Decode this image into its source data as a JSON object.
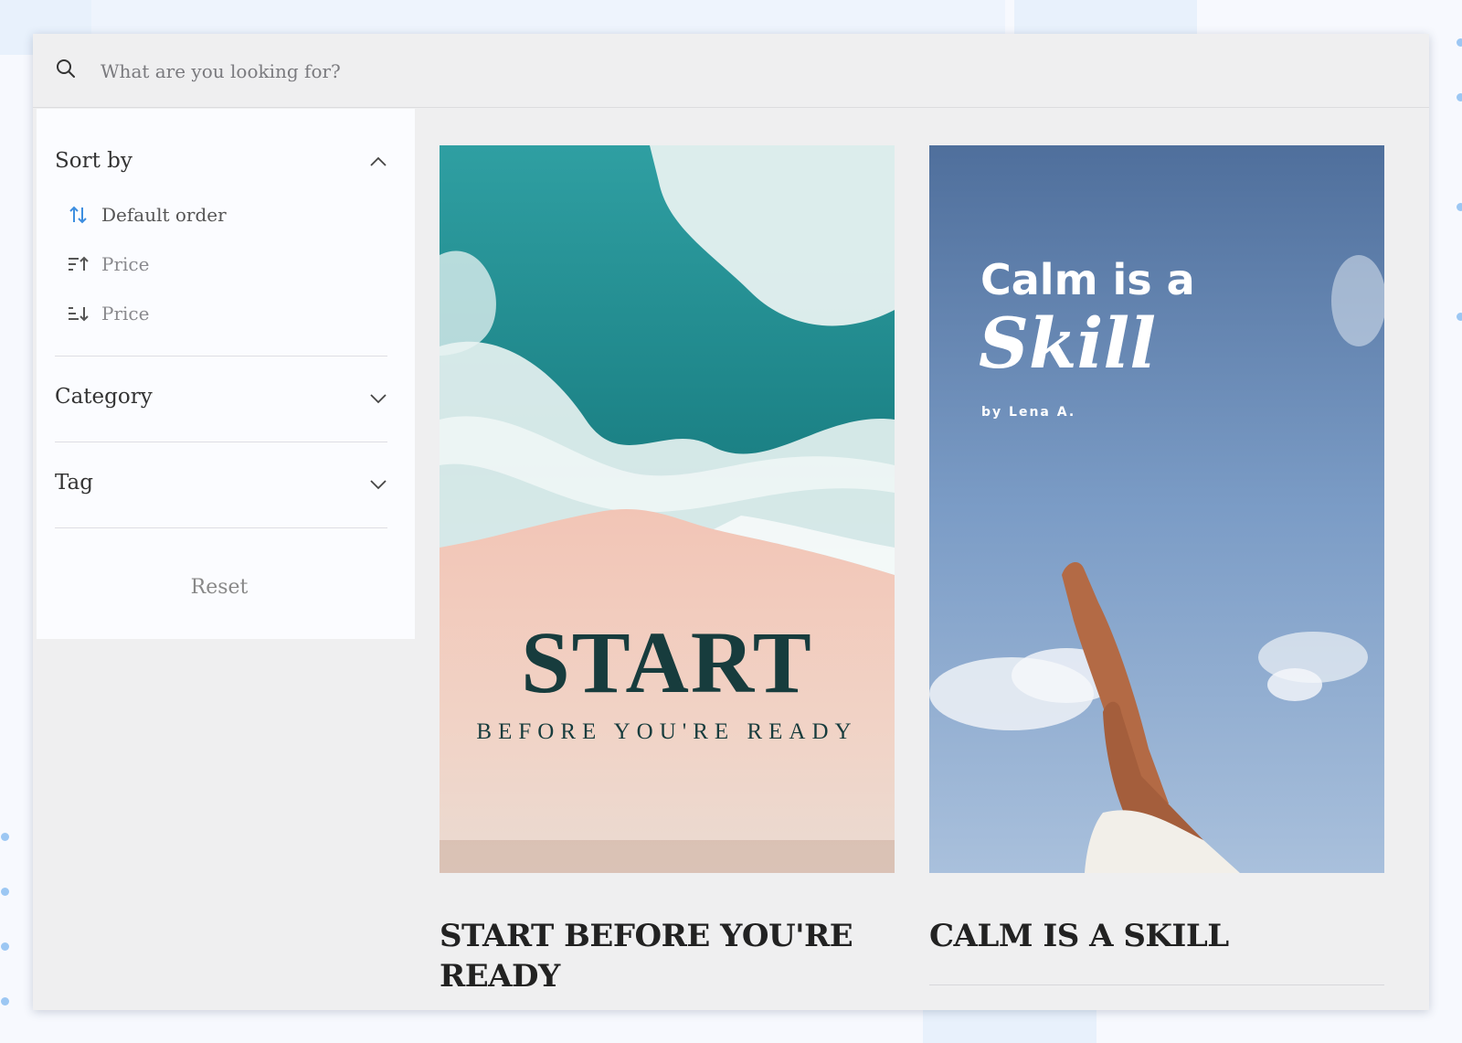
{
  "search": {
    "placeholder": "What are you looking for?",
    "icon": "search-icon"
  },
  "sidebar": {
    "sort_by": {
      "title": "Sort by",
      "expanded": true,
      "options": [
        {
          "label": "Default order",
          "icon": "sort-default-icon",
          "active": true
        },
        {
          "label": "Price",
          "icon": "sort-ascending-icon",
          "active": false
        },
        {
          "label": "Price",
          "icon": "sort-descending-icon",
          "active": false
        }
      ]
    },
    "category": {
      "title": "Category",
      "expanded": false
    },
    "tag": {
      "title": "Tag",
      "expanded": false
    },
    "reset_label": "Reset"
  },
  "products": [
    {
      "title": "START BEFORE YOU'RE READY",
      "cover": {
        "headline": "START",
        "subtitle": "BEFORE YOU'RE READY"
      }
    },
    {
      "title": "CALM IS A SKILL",
      "cover": {
        "line1": "Calm is a",
        "line2": "Skill",
        "author": "by Lena A."
      }
    }
  ],
  "colors": {
    "accent": "#3d8ee0",
    "panel_bg": "#efeff0",
    "sidebar_bg": "#fbfcff",
    "title_text": "#222222"
  }
}
